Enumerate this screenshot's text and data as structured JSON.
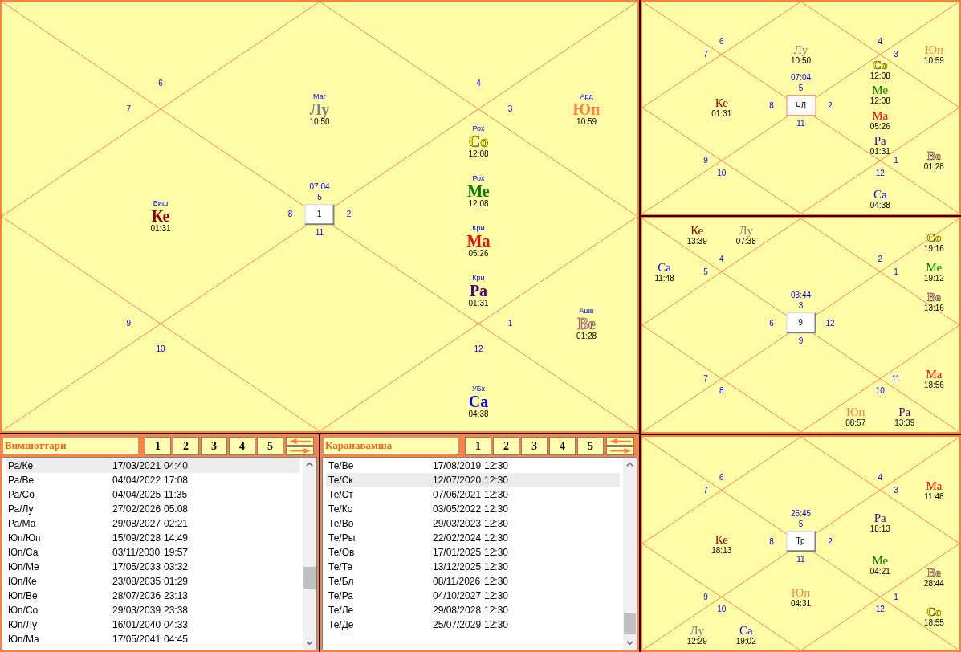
{
  "main_chart": {
    "center": {
      "label": "1",
      "time": "07:04",
      "highlighted": false
    },
    "houses": [
      {
        "sign": "5",
        "planets": [
          {
            "name": "Лу",
            "nakshatra": "Маг",
            "time": "10:50",
            "color": "#808080"
          }
        ]
      },
      {
        "sign": "6"
      },
      {
        "sign": "7"
      },
      {
        "sign": "8",
        "planets": [
          {
            "name": "Ке",
            "nakshatra": "Виш",
            "time": "01:31",
            "color": "#8b0000"
          }
        ]
      },
      {
        "sign": "9"
      },
      {
        "sign": "10"
      },
      {
        "sign": "11"
      },
      {
        "sign": "12",
        "planets": [
          {
            "name": "Са",
            "nakshatra": "УБх",
            "time": "04:38",
            "color": "#0000ff"
          }
        ]
      },
      {
        "sign": "1",
        "planets": [
          {
            "name": "Ве",
            "nakshatra": "Ашв",
            "time": "01:28",
            "color": "#ffc0cb"
          }
        ]
      },
      {
        "sign": "2",
        "planets": [
          {
            "name": "Со",
            "nakshatra": "Рох",
            "time": "12:08",
            "color": "#ffff00"
          },
          {
            "name": "Ме",
            "nakshatra": "Рох",
            "time": "12:08",
            "color": "#008000"
          },
          {
            "name": "Ма",
            "nakshatra": "Кри",
            "time": "05:26",
            "color": "#ff0000"
          },
          {
            "name": "Ра",
            "nakshatra": "Кри",
            "time": "01:31",
            "color": "#4b0082"
          }
        ]
      },
      {
        "sign": "3",
        "planets": [
          {
            "name": "Юп",
            "nakshatra": "Ард",
            "time": "10:59",
            "color": "#ff7f3f"
          }
        ]
      },
      {
        "sign": "4"
      }
    ]
  },
  "side_charts": [
    {
      "center": {
        "label": "ЧЛ",
        "time": "07:04",
        "highlighted": true
      },
      "houses": [
        {
          "sign": "5",
          "planets": [
            {
              "name": "Лу",
              "time": "10:50",
              "color": "#808080"
            }
          ]
        },
        {
          "sign": "6"
        },
        {
          "sign": "7"
        },
        {
          "sign": "8",
          "planets": [
            {
              "name": "Ке",
              "time": "01:31",
              "color": "#8b0000"
            }
          ]
        },
        {
          "sign": "9"
        },
        {
          "sign": "10"
        },
        {
          "sign": "11"
        },
        {
          "sign": "12",
          "planets": [
            {
              "name": "Са",
              "time": "04:38",
              "color": "#0000ff"
            }
          ]
        },
        {
          "sign": "1",
          "planets": [
            {
              "name": "Ве",
              "time": "01:28",
              "color": "#ffc0cb"
            }
          ]
        },
        {
          "sign": "2",
          "planets": [
            {
              "name": "Со",
              "time": "12:08",
              "color": "#ffff00"
            },
            {
              "name": "Ме",
              "time": "12:08",
              "color": "#008000"
            },
            {
              "name": "Ма",
              "time": "05:26",
              "color": "#ff0000"
            },
            {
              "name": "Ра",
              "time": "01:31",
              "color": "#4b0082"
            }
          ]
        },
        {
          "sign": "3",
          "planets": [
            {
              "name": "Юп",
              "time": "10:59",
              "color": "#ff7f3f"
            }
          ]
        },
        {
          "sign": "4"
        }
      ]
    },
    {
      "center": {
        "label": "9",
        "time": "03:44",
        "highlighted": false
      },
      "houses": [
        {
          "sign": "3"
        },
        {
          "sign": "4",
          "planets": [
            {
              "name": "Ке",
              "time": "13:39",
              "color": "#8b0000"
            },
            {
              "name": "Лу",
              "time": "07:38",
              "color": "#808080"
            }
          ]
        },
        {
          "sign": "5",
          "planets": [
            {
              "name": "Са",
              "time": "11:48",
              "color": "#0000ff"
            }
          ]
        },
        {
          "sign": "6"
        },
        {
          "sign": "7"
        },
        {
          "sign": "8"
        },
        {
          "sign": "9"
        },
        {
          "sign": "10",
          "planets": [
            {
              "name": "Юп",
              "time": "08:57",
              "color": "#ff7f3f"
            },
            {
              "name": "Ра",
              "time": "13:39",
              "color": "#4b0082"
            }
          ]
        },
        {
          "sign": "11",
          "planets": [
            {
              "name": "Ма",
              "time": "18:56",
              "color": "#ff0000"
            }
          ]
        },
        {
          "sign": "12"
        },
        {
          "sign": "1",
          "planets": [
            {
              "name": "Со",
              "time": "19:16",
              "color": "#ffff00"
            },
            {
              "name": "Ме",
              "time": "19:12",
              "color": "#008000"
            },
            {
              "name": "Ве",
              "time": "13:16",
              "color": "#ffc0cb"
            }
          ]
        },
        {
          "sign": "2"
        }
      ]
    },
    {
      "center": {
        "label": "Тр",
        "time": "25:45",
        "highlighted": false
      },
      "houses": [
        {
          "sign": "5"
        },
        {
          "sign": "6"
        },
        {
          "sign": "7"
        },
        {
          "sign": "8",
          "planets": [
            {
              "name": "Ке",
              "time": "18:13",
              "color": "#8b0000"
            }
          ]
        },
        {
          "sign": "9"
        },
        {
          "sign": "10",
          "planets": [
            {
              "name": "Лу",
              "time": "12:29",
              "color": "#808080"
            },
            {
              "name": "Са",
              "time": "19:02",
              "color": "#0000ff"
            }
          ]
        },
        {
          "sign": "11",
          "planets": [
            {
              "name": "Юп",
              "time": "04:31",
              "color": "#ff7f3f"
            }
          ]
        },
        {
          "sign": "12"
        },
        {
          "sign": "1",
          "planets": [
            {
              "name": "Ве",
              "time": "28:44",
              "color": "#ffc0cb"
            },
            {
              "name": "Со",
              "time": "18:55",
              "color": "#ffff00"
            }
          ]
        },
        {
          "sign": "2",
          "planets": [
            {
              "name": "Ра",
              "time": "18:13",
              "color": "#4b0082"
            },
            {
              "name": "Ме",
              "time": "04:21",
              "color": "#008000"
            }
          ]
        },
        {
          "sign": "3",
          "planets": [
            {
              "name": "Ма",
              "time": "11:48",
              "color": "#ff0000"
            }
          ]
        },
        {
          "sign": "4"
        }
      ]
    }
  ],
  "panels": [
    {
      "title": "Вимшоттари",
      "buttons": [
        "1",
        "2",
        "3",
        "4",
        "5"
      ],
      "rows": [
        {
          "period": "Ра/Ке",
          "date": "17/03/2021",
          "time": "04:40",
          "selected": true
        },
        {
          "period": "Ра/Ве",
          "date": "04/04/2022",
          "time": "17:08",
          "selected": false
        },
        {
          "period": "Ра/Со",
          "date": "04/04/2025",
          "time": "11:35",
          "selected": false
        },
        {
          "period": "Ра/Лу",
          "date": "27/02/2026",
          "time": "05:08",
          "selected": false
        },
        {
          "period": "Ра/Ма",
          "date": "29/08/2027",
          "time": "02:21",
          "selected": false
        },
        {
          "period": "Юп/Юп",
          "date": "15/09/2028",
          "time": "14:49",
          "selected": false
        },
        {
          "period": "Юп/Са",
          "date": "03/11/2030",
          "time": "19:57",
          "selected": false
        },
        {
          "period": "Юп/Ме",
          "date": "17/05/2033",
          "time": "03:32",
          "selected": false
        },
        {
          "period": "Юп/Ке",
          "date": "23/08/2035",
          "time": "01:29",
          "selected": false
        },
        {
          "period": "Юп/Ве",
          "date": "28/07/2036",
          "time": "23:13",
          "selected": false
        },
        {
          "period": "Юп/Со",
          "date": "29/03/2039",
          "time": "23:38",
          "selected": false
        },
        {
          "period": "Юп/Лу",
          "date": "16/01/2040",
          "time": "04:33",
          "selected": false
        },
        {
          "period": "Юп/Ма",
          "date": "17/05/2041",
          "time": "04:45",
          "selected": false
        }
      ]
    },
    {
      "title": "Каранавамша",
      "buttons": [
        "1",
        "2",
        "3",
        "4",
        "5"
      ],
      "rows": [
        {
          "period": "Те/Ве",
          "date": "17/08/2019",
          "time": "12:30",
          "selected": false
        },
        {
          "period": "Те/Ск",
          "date": "12/07/2020",
          "time": "12:30",
          "selected": true
        },
        {
          "period": "Те/Ст",
          "date": "07/06/2021",
          "time": "12:30",
          "selected": false
        },
        {
          "period": "Те/Ко",
          "date": "03/05/2022",
          "time": "12:30",
          "selected": false
        },
        {
          "period": "Те/Во",
          "date": "29/03/2023",
          "time": "12:30",
          "selected": false
        },
        {
          "period": "Те/Ры",
          "date": "22/02/2024",
          "time": "12:30",
          "selected": false
        },
        {
          "period": "Те/Ов",
          "date": "17/01/2025",
          "time": "12:30",
          "selected": false
        },
        {
          "period": "Те/Те",
          "date": "13/12/2025",
          "time": "12:30",
          "selected": false
        },
        {
          "period": "Те/Бл",
          "date": "08/11/2026",
          "time": "12:30",
          "selected": false
        },
        {
          "period": "Те/Ра",
          "date": "04/10/2027",
          "time": "12:30",
          "selected": false
        },
        {
          "period": "Те/Ле",
          "date": "29/08/2028",
          "time": "12:30",
          "selected": false
        },
        {
          "period": "Те/Де",
          "date": "25/07/2029",
          "time": "12:30",
          "selected": false
        }
      ]
    }
  ]
}
